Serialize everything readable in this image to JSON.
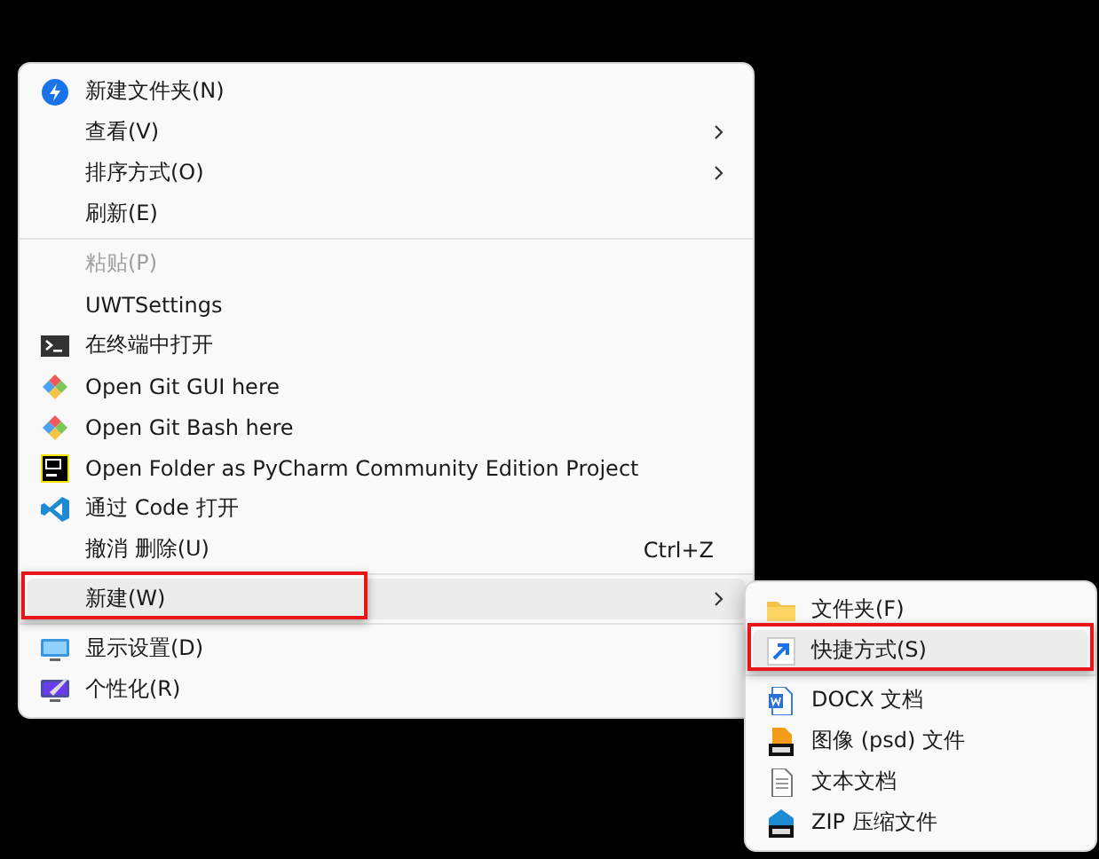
{
  "context_menu": {
    "sections": [
      [
        {
          "kind": "bolt",
          "label": "新建文件夹(N)",
          "has_submenu": false,
          "disabled": false,
          "selected": false,
          "annotated": false
        },
        {
          "kind": "plain",
          "label": "查看(V)",
          "has_submenu": true,
          "disabled": false,
          "selected": false,
          "annotated": false
        },
        {
          "kind": "plain",
          "label": "排序方式(O)",
          "has_submenu": true,
          "disabled": false,
          "selected": false,
          "annotated": false
        },
        {
          "kind": "plain",
          "label": "刷新(E)",
          "has_submenu": false,
          "disabled": false,
          "selected": false,
          "annotated": false
        }
      ],
      [
        {
          "kind": "plain",
          "label": "粘贴(P)",
          "has_submenu": false,
          "disabled": true,
          "selected": false,
          "annotated": false
        },
        {
          "kind": "plain",
          "label": "UWTSettings",
          "has_submenu": false,
          "disabled": false,
          "selected": false,
          "annotated": false
        },
        {
          "kind": "terminal",
          "label": "在终端中打开",
          "has_submenu": false,
          "disabled": false,
          "selected": false,
          "annotated": false
        },
        {
          "kind": "git",
          "label": "Open Git GUI here",
          "has_submenu": false,
          "disabled": false,
          "selected": false,
          "annotated": false
        },
        {
          "kind": "git",
          "label": "Open Git Bash here",
          "has_submenu": false,
          "disabled": false,
          "selected": false,
          "annotated": false
        },
        {
          "kind": "pycharm",
          "label": "Open Folder as PyCharm Community Edition Project",
          "has_submenu": false,
          "disabled": false,
          "selected": false,
          "annotated": false
        },
        {
          "kind": "vscode",
          "label": "通过 Code 打开",
          "has_submenu": false,
          "disabled": false,
          "selected": false,
          "annotated": false
        },
        {
          "kind": "plain",
          "label": "撤消 删除(U)",
          "shortcut": "Ctrl+Z",
          "has_submenu": false,
          "disabled": false,
          "selected": false,
          "annotated": false
        }
      ],
      [
        {
          "kind": "plain",
          "label": "新建(W)",
          "has_submenu": true,
          "disabled": false,
          "selected": true,
          "annotated": true
        }
      ],
      [
        {
          "kind": "monitor",
          "label": "显示设置(D)",
          "has_submenu": false,
          "disabled": false,
          "selected": false,
          "annotated": false
        },
        {
          "kind": "personalize",
          "label": "个性化(R)",
          "has_submenu": false,
          "disabled": false,
          "selected": false,
          "annotated": false
        }
      ]
    ]
  },
  "new_submenu": {
    "sections": [
      [
        {
          "kind": "folder",
          "label": "文件夹(F)",
          "has_submenu": false,
          "disabled": false,
          "selected": false,
          "annotated": false
        },
        {
          "kind": "shortcut",
          "label": "快捷方式(S)",
          "has_submenu": false,
          "disabled": false,
          "selected": true,
          "annotated": true
        }
      ],
      [
        {
          "kind": "docx",
          "label": "DOCX 文档",
          "has_submenu": false,
          "disabled": false,
          "selected": false,
          "annotated": false
        },
        {
          "kind": "psd",
          "label": "图像 (psd) 文件",
          "has_submenu": false,
          "disabled": false,
          "selected": false,
          "annotated": false
        },
        {
          "kind": "text",
          "label": "文本文档",
          "has_submenu": false,
          "disabled": false,
          "selected": false,
          "annotated": false
        },
        {
          "kind": "zip",
          "label": "ZIP 压缩文件",
          "has_submenu": false,
          "disabled": false,
          "selected": false,
          "annotated": false
        }
      ]
    ]
  }
}
